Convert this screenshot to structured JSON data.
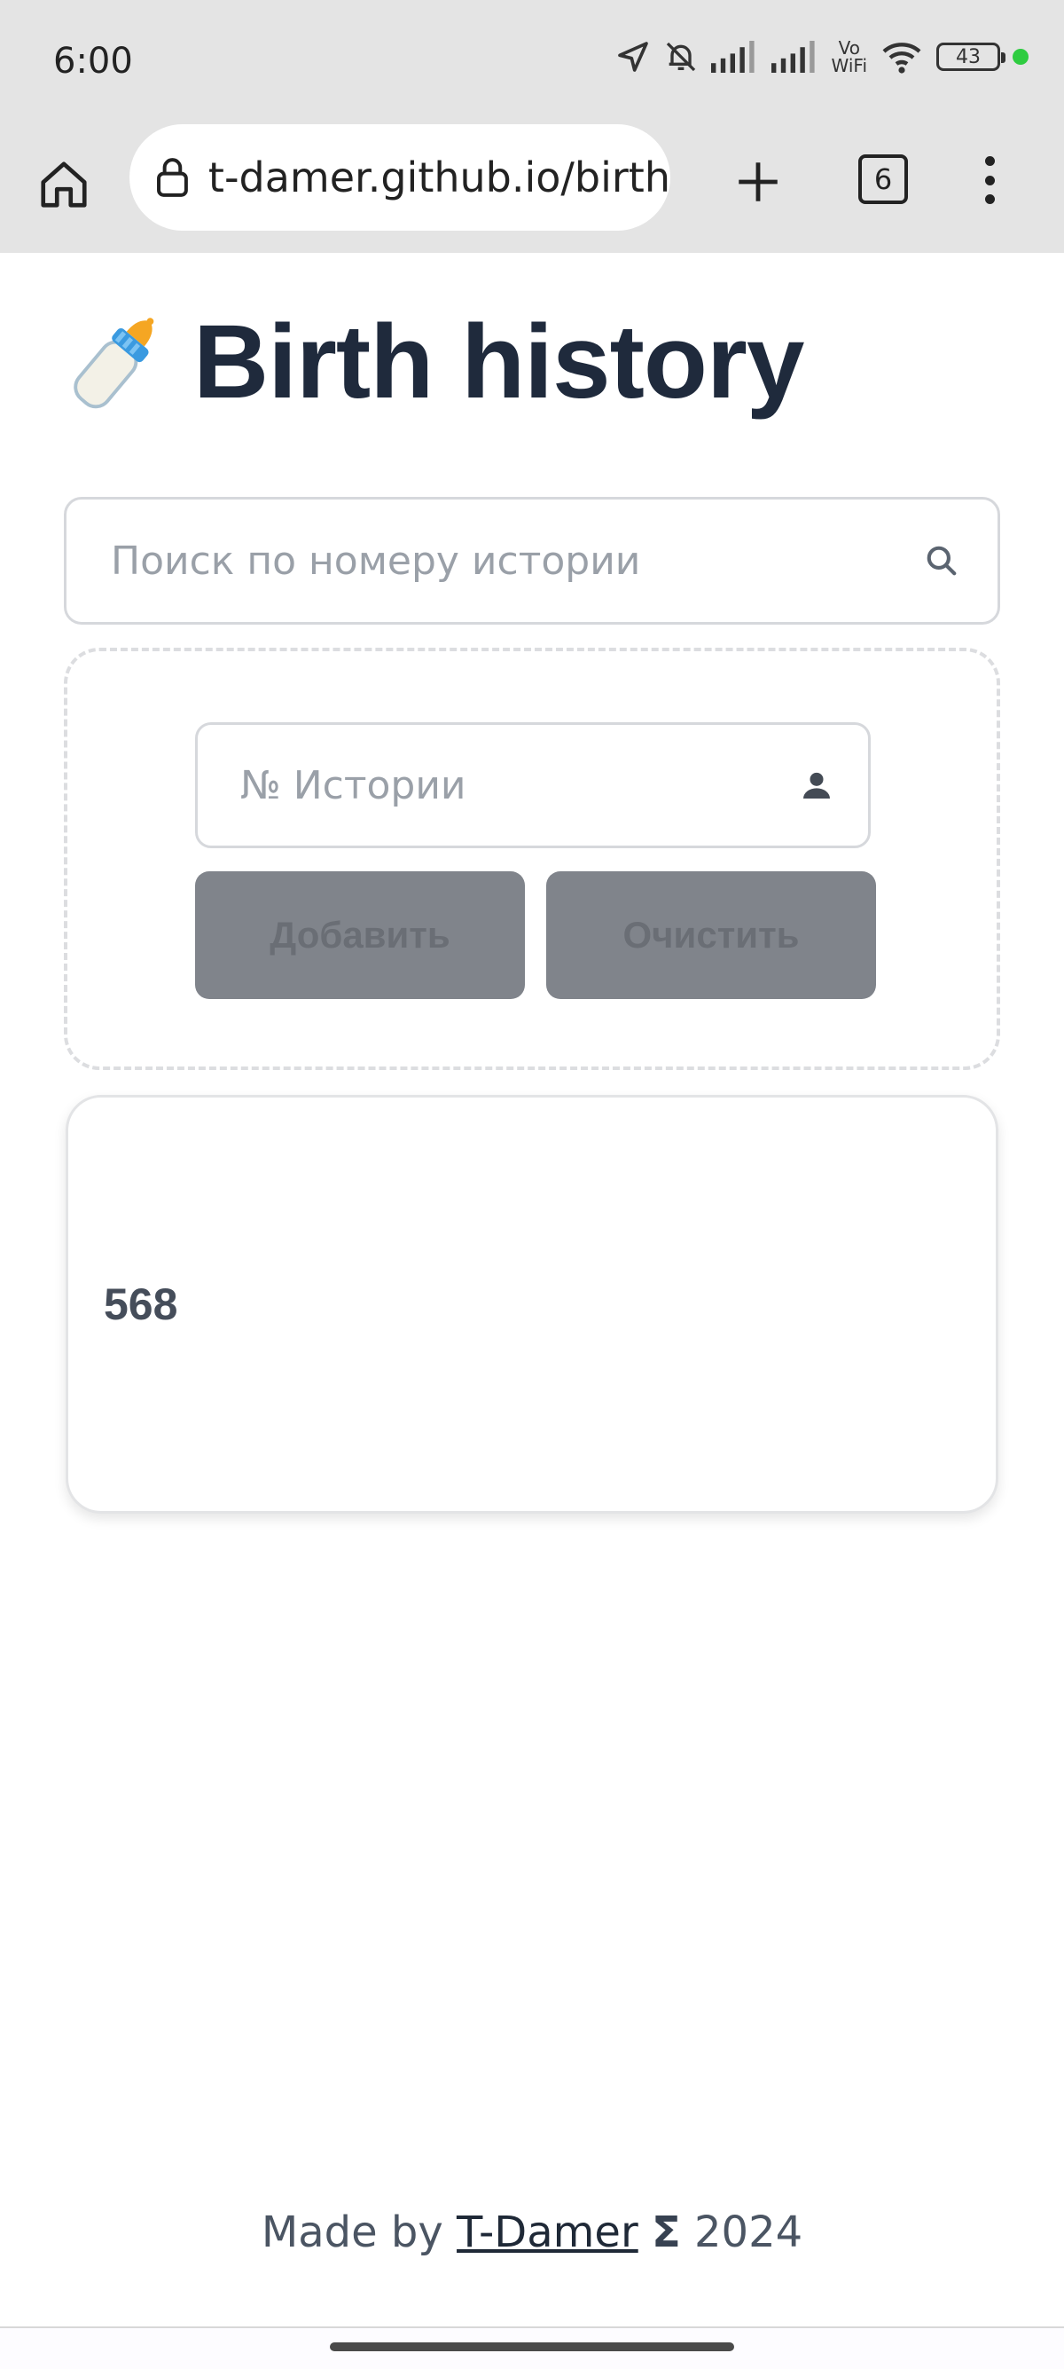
{
  "status_bar": {
    "time": "6:00",
    "battery": "43",
    "vowifi_top": "Vo",
    "vowifi_bottom": "WiFi",
    "icons": [
      "location-icon",
      "bell-off-icon",
      "signal-icon",
      "signal-icon",
      "vowifi-icon",
      "wifi-icon",
      "battery-icon",
      "green-dot"
    ]
  },
  "browser": {
    "url": "t-damer.github.io/birth",
    "tab_count": "6",
    "icons": [
      "home-icon",
      "lock-icon",
      "plus-icon",
      "tabs-icon",
      "more-vert-icon"
    ]
  },
  "page": {
    "title": "Birth history",
    "title_icon": "baby-bottle-icon",
    "search_placeholder": "Поиск по номеру истории",
    "history_placeholder": "№ Истории",
    "add_label": "Добавить",
    "clear_label": "Очистить",
    "records": [
      "568"
    ]
  },
  "footer": {
    "made_by": "Made by",
    "author": "T-Damer",
    "sigma": "Σ",
    "year": "2024"
  },
  "colors": {
    "title": "#1f2a3c",
    "button_bg": "#80848b",
    "status_dot": "#2ecc40"
  }
}
